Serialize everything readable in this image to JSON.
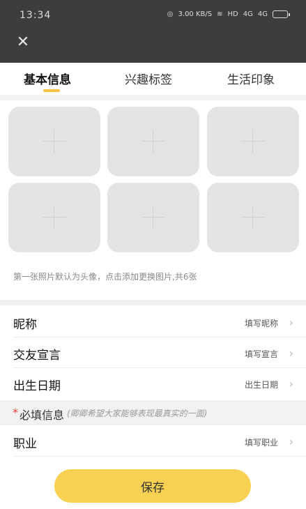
{
  "status_bar": {
    "time": "13:34",
    "net_speed": "3.00 KB/S",
    "network": "HD",
    "signal1": "4G",
    "signal2": "4G"
  },
  "header": {
    "close_icon": "close-icon"
  },
  "tabs": [
    {
      "label": "基本信息",
      "active": true
    },
    {
      "label": "兴趣标签",
      "active": false
    },
    {
      "label": "生活印象",
      "active": false
    }
  ],
  "photos": {
    "slot_count": 6,
    "hint": "第一张照片默认为头像，点击添加更换图片,共6张"
  },
  "rows": [
    {
      "label": "昵称",
      "value": "填写昵称"
    },
    {
      "label": "交友宣言",
      "value": "填写宣言"
    },
    {
      "label": "出生日期",
      "value": "出生日期"
    }
  ],
  "required": {
    "star": "*",
    "title": "必填信息",
    "subtitle": "(卿卿希望大家能够表现最真实的一面)"
  },
  "job_row": {
    "label": "职业",
    "value": "填写职业"
  },
  "save_label": "保存",
  "colors": {
    "accent": "#f6c242",
    "button": "#f8d152",
    "topbar": "#3d3d3f"
  }
}
